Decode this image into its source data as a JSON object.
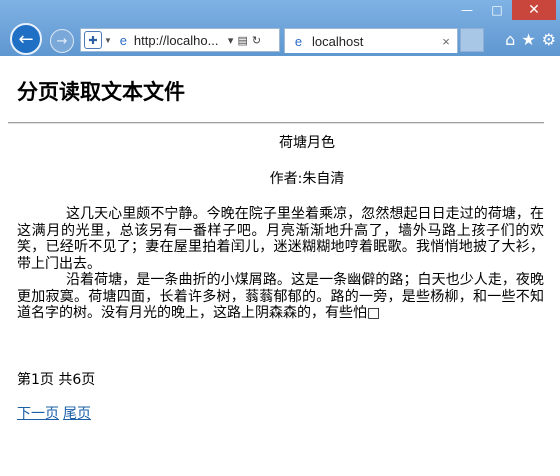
{
  "browser": {
    "url": "http://localho...",
    "tab_title": "localhost",
    "window_controls": {
      "minimize": "—",
      "maximize": "□",
      "close": "✕"
    },
    "tab_close": "×"
  },
  "page": {
    "heading": "分页读取文本文件",
    "article_title": "荷塘月色",
    "author": "作者:朱自清",
    "paragraphs": [
      "这几天心里颇不宁静。今晚在院子里坐着乘凉，忽然想起日日走过的荷塘，在这满月的光里，总该另有一番样子吧。月亮渐渐地升高了，墙外马路上孩子们的欢笑，已经听不见了；妻在屋里拍着闰儿，迷迷糊糊地哼着眠歌。我悄悄地披了大衫，带上门出去。",
      "沿着荷塘，是一条曲折的小煤屑路。这是一条幽僻的路；白天也少人走，夜晚更加寂寞。荷塘四面，长着许多树，蓊蓊郁郁的。路的一旁，是些杨柳，和一些不知道名字的树。没有月光的晚上，这路上阴森森的，有些怕□"
    ],
    "page_info": "第1页  共6页",
    "next_link": "下一页",
    "last_link": "尾页"
  },
  "colors": {
    "chrome": "#6aa0d6",
    "back_button": "#1f6fc5",
    "close_button": "#c9463d",
    "link": "#1a5fa8"
  },
  "icons": [
    "back-arrow-icon",
    "forward-arrow-icon",
    "shield-icon",
    "page-icon",
    "home-icon",
    "star-icon",
    "gear-icon"
  ]
}
